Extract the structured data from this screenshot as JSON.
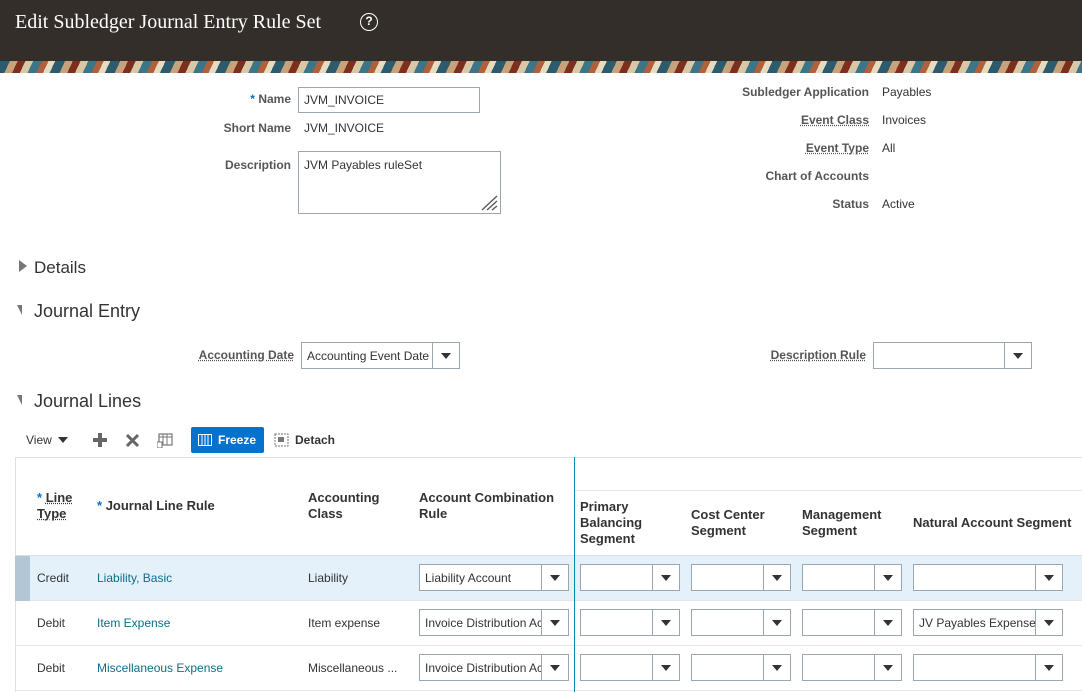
{
  "header": {
    "title": "Edit Subledger Journal Entry Rule Set",
    "help": "?"
  },
  "form": {
    "name_label": "Name",
    "name_value": "JVM_INVOICE",
    "short_name_label": "Short Name",
    "short_name_value": "JVM_INVOICE",
    "description_label": "Description",
    "description_value": "JVM Payables ruleSet",
    "subledger_app_label": "Subledger Application",
    "subledger_app_value": "Payables",
    "event_class_label": "Event Class",
    "event_class_value": "Invoices",
    "event_type_label": "Event Type",
    "event_type_value": "All",
    "coa_label": "Chart of Accounts",
    "status_label": "Status",
    "status_value": "Active",
    "required_mark": "*"
  },
  "sections": {
    "details": "Details",
    "journal_entry": "Journal Entry",
    "journal_lines": "Journal Lines"
  },
  "journal_entry": {
    "accounting_date_label": "Accounting Date",
    "accounting_date_value": "Accounting Event Date",
    "description_rule_label": "Description Rule",
    "description_rule_value": ""
  },
  "toolbar": {
    "view": "View",
    "freeze": "Freeze",
    "detach": "Detach"
  },
  "table": {
    "columns": {
      "line_type_1": "Line",
      "line_type_2": "Type",
      "journal_line_rule": "Journal Line Rule",
      "accounting_class_1": "Accounting",
      "accounting_class_2": "Class",
      "acct_combo_1": "Account Combination",
      "acct_combo_2": "Rule",
      "primary_bal_1": "Primary",
      "primary_bal_2": "Balancing",
      "primary_bal_3": "Segment",
      "cost_center_1": "Cost Center",
      "cost_center_2": "Segment",
      "management_1": "Management",
      "management_2": "Segment",
      "natural_account": "Natural Account Segment"
    },
    "rows": [
      {
        "line_type": "Credit",
        "journal_line_rule": "Liability, Basic",
        "accounting_class": "Liability",
        "acct_combo_rule": "Liability Account",
        "primary_bal": "",
        "cost_center": "",
        "management": "",
        "natural_account": ""
      },
      {
        "line_type": "Debit",
        "journal_line_rule": "Item Expense",
        "accounting_class": "Item expense",
        "acct_combo_rule": "Invoice Distribution Account",
        "primary_bal": "",
        "cost_center": "",
        "management": "",
        "natural_account": "JV Payables Expense"
      },
      {
        "line_type": "Debit",
        "journal_line_rule": "Miscellaneous Expense",
        "accounting_class": "Miscellaneous ...",
        "acct_combo_rule": "Invoice Distribution Account",
        "primary_bal": "",
        "cost_center": "",
        "management": "",
        "natural_account": ""
      }
    ]
  }
}
